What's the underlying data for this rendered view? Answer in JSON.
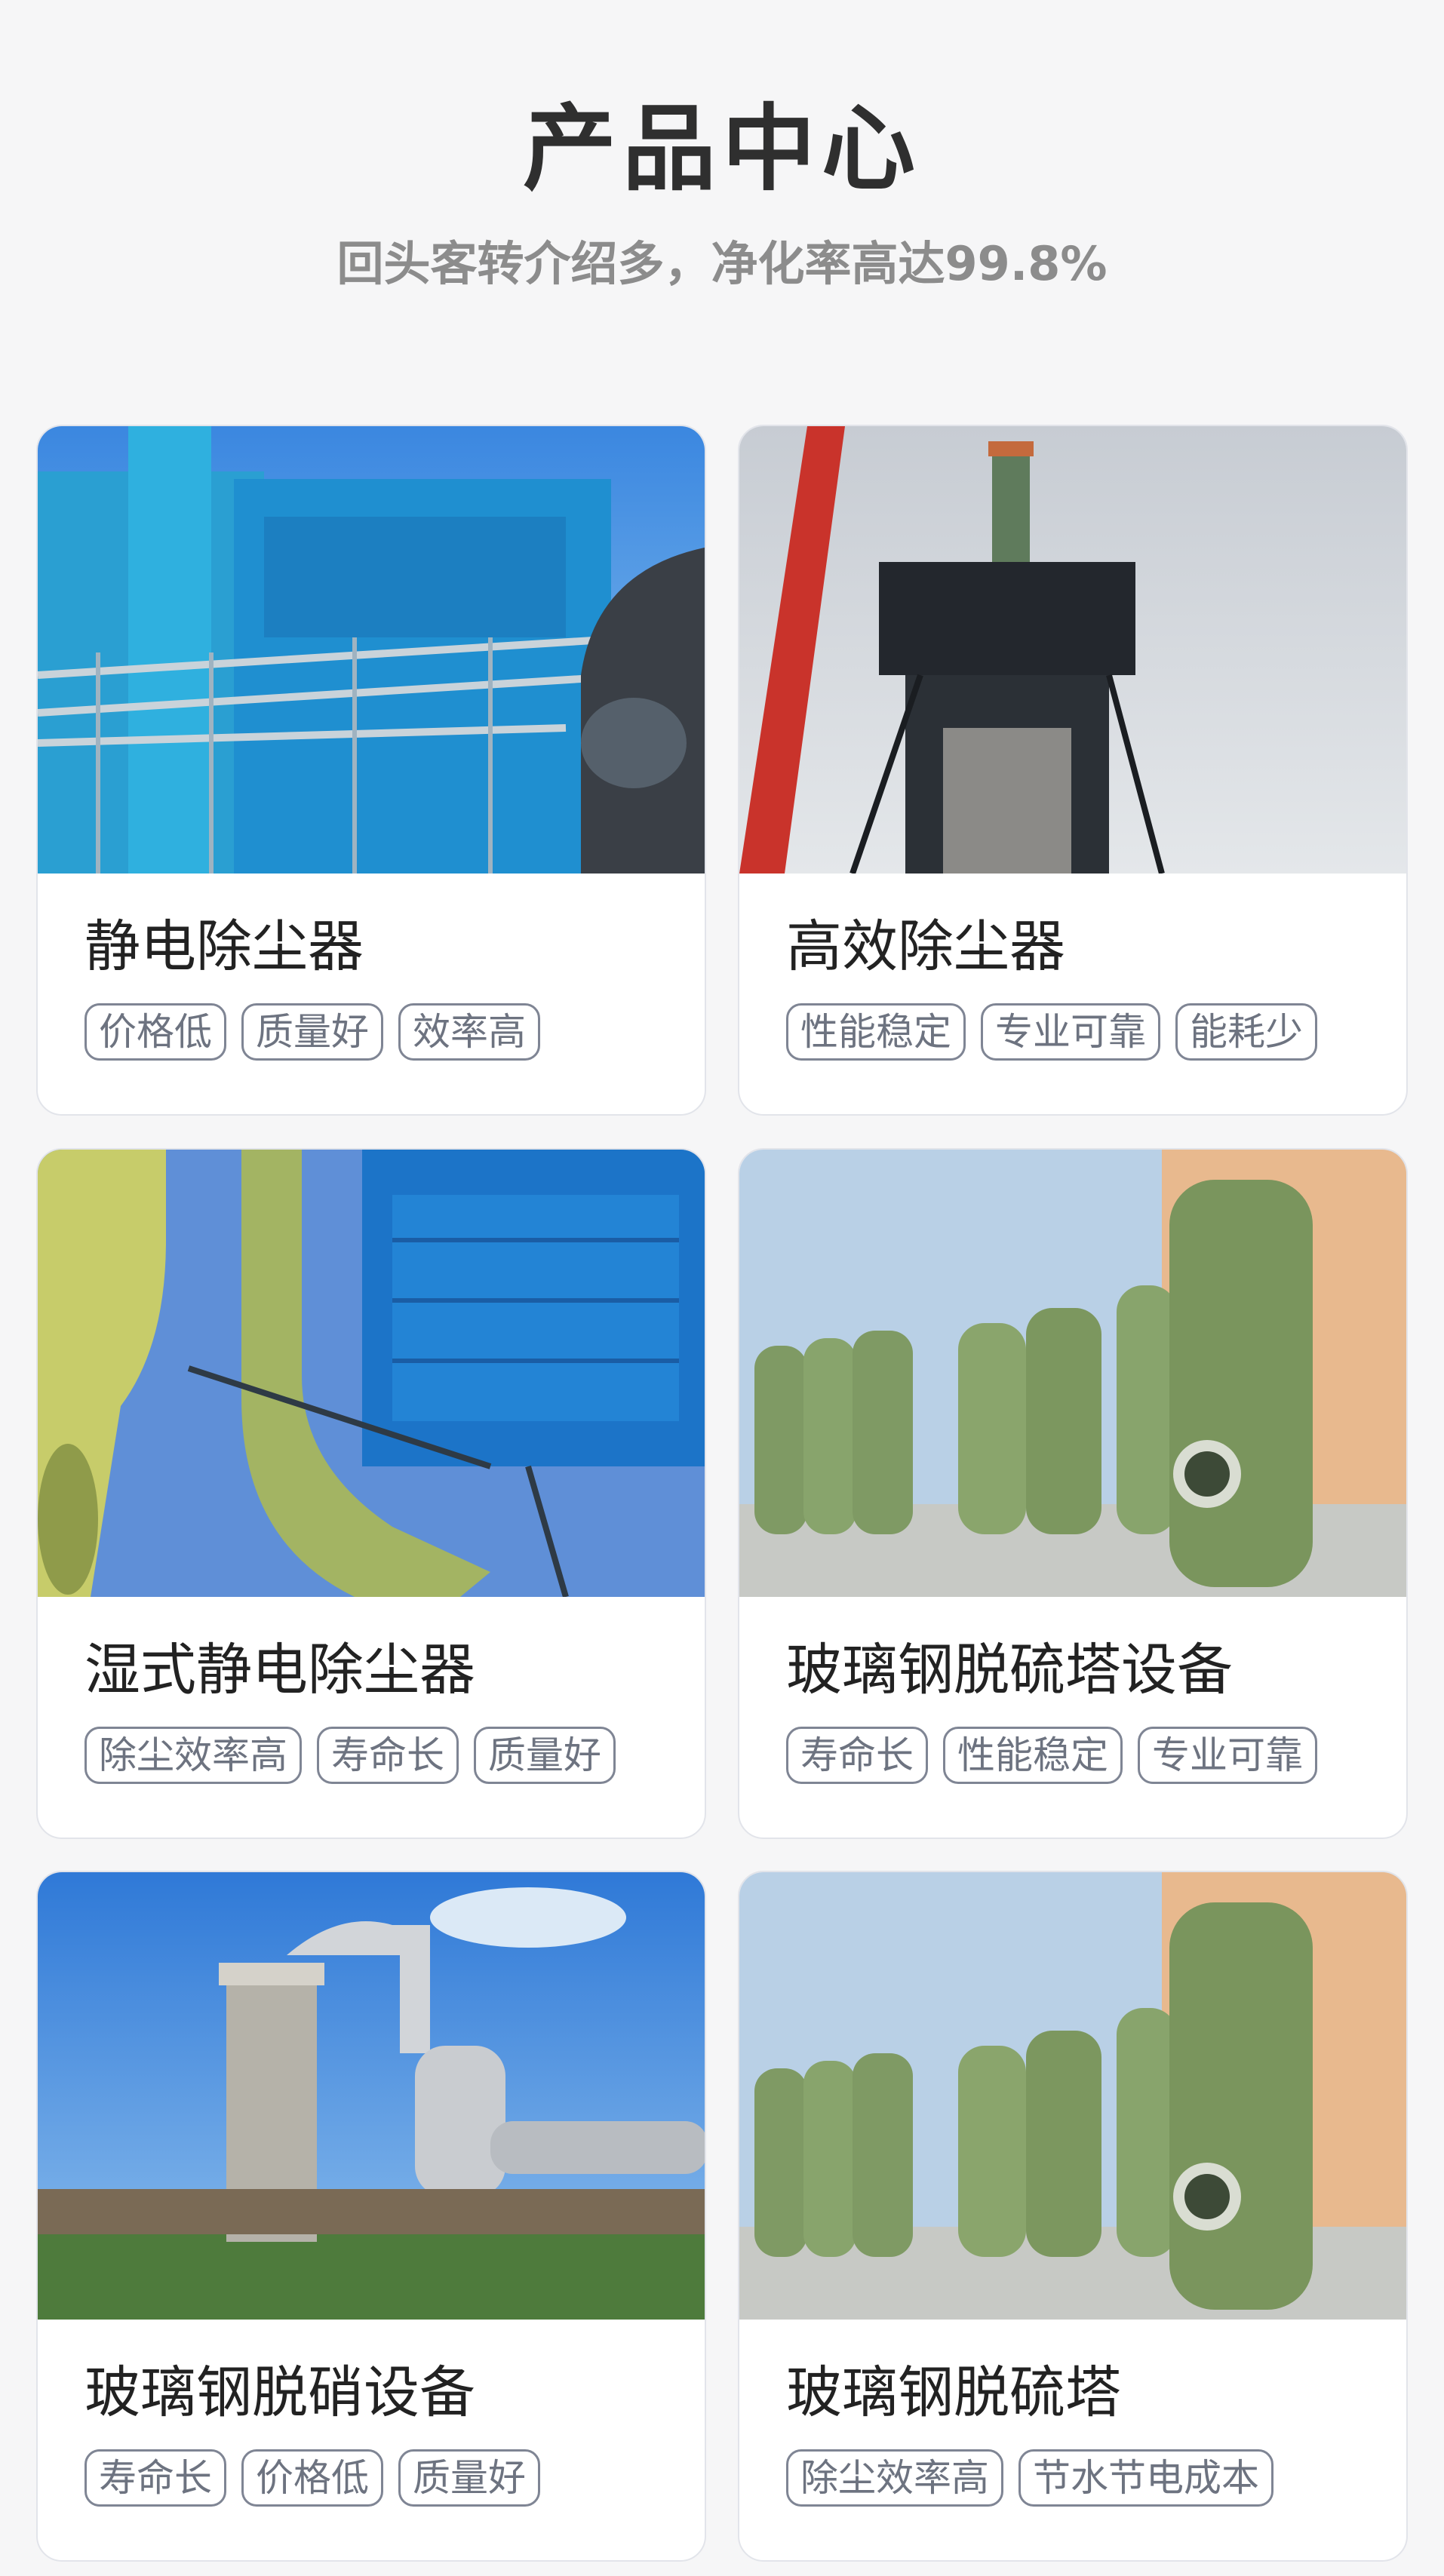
{
  "header": {
    "title": "产品中心",
    "subtitle": "回头客转介绍多，净化率高达99.8%"
  },
  "products": [
    {
      "name": "静电除尘器",
      "tags": [
        "价格低",
        "质量好",
        "效率高"
      ],
      "image": "blue-industrial-dust-collector-photo"
    },
    {
      "name": "高效除尘器",
      "tags": [
        "性能稳定",
        "专业可靠",
        "能耗少"
      ],
      "image": "dust-collector-tower-with-crane-photo"
    },
    {
      "name": "湿式静电除尘器",
      "tags": [
        "除尘效率高",
        "寿命长",
        "质量好"
      ],
      "image": "green-frp-pipes-blue-structure-photo"
    },
    {
      "name": "玻璃钢脱硫塔设备",
      "tags": [
        "寿命长",
        "性能稳定",
        "专业可靠"
      ],
      "image": "green-frp-desulfurization-towers-photo"
    },
    {
      "name": "玻璃钢脱硝设备",
      "tags": [
        "寿命长",
        "价格低",
        "质量好"
      ],
      "image": "plant-with-tower-and-silver-ducts-photo"
    },
    {
      "name": "玻璃钢脱硫塔",
      "tags": [
        "除尘效率高",
        "节水节电成本"
      ],
      "image": "green-frp-desulfurization-towers-photo"
    }
  ],
  "colors": {
    "background": "#f6f6f7",
    "card_border": "#e2e4ea",
    "tag_border": "#7f8594",
    "tag_text": "#6d7380",
    "title": "#2f2f2f",
    "subtitle": "#8c8c8c"
  }
}
